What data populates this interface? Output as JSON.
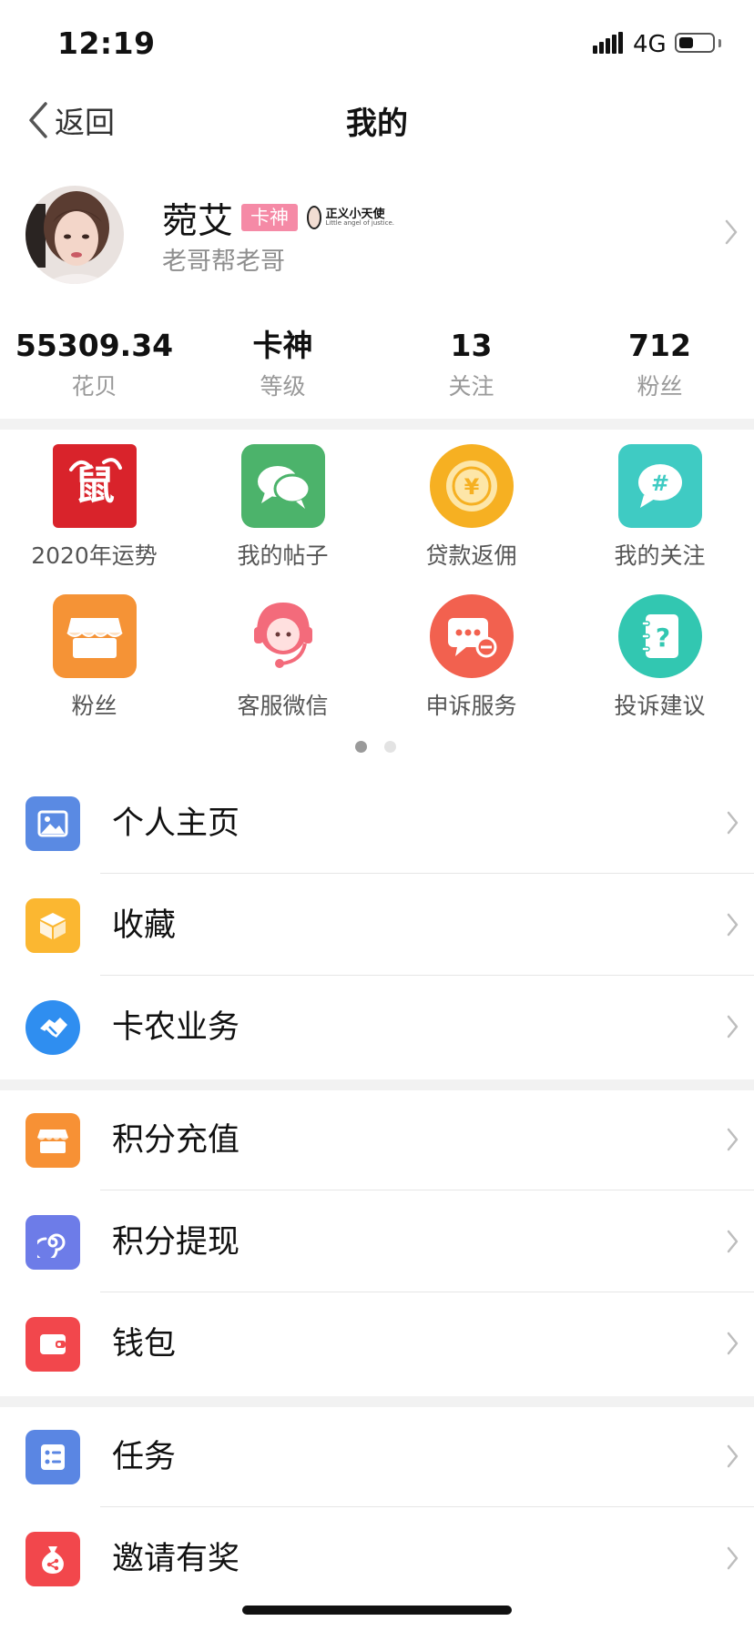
{
  "status_bar": {
    "time": "12:19",
    "network": "4G",
    "battery_level": 0.45
  },
  "nav": {
    "back_label": "返回",
    "title": "我的"
  },
  "profile": {
    "name": "菀艾",
    "rank_badge": "卡神",
    "honor_badge": {
      "title": "正义小天使",
      "subtitle": "Little angel of justice."
    },
    "subtitle": "老哥帮老哥"
  },
  "stats": [
    {
      "value": "55309.34",
      "label": "花贝"
    },
    {
      "value": "卡神",
      "label": "等级"
    },
    {
      "value": "13",
      "label": "关注"
    },
    {
      "value": "712",
      "label": "粉丝"
    }
  ],
  "grid": [
    {
      "label": "2020年运势",
      "icon": "fortune-rat-icon",
      "color": "#d9232b"
    },
    {
      "label": "我的帖子",
      "icon": "chat-bubbles-icon",
      "color": "#4cb36b"
    },
    {
      "label": "贷款返佣",
      "icon": "yen-coin-icon",
      "color": "#f6b022"
    },
    {
      "label": "我的关注",
      "icon": "hashtag-icon",
      "color": "#3fcbc3"
    },
    {
      "label": "粉丝",
      "icon": "shop-icon",
      "color": "#f59336"
    },
    {
      "label": "客服微信",
      "icon": "headset-agent-icon",
      "color": "#f36b7b"
    },
    {
      "label": "申诉服务",
      "icon": "message-dots-icon",
      "color": "#f2614f"
    },
    {
      "label": "投诉建议",
      "icon": "question-note-icon",
      "color": "#32c7b1"
    }
  ],
  "pager": {
    "pages": 2,
    "active": 1
  },
  "menu": [
    {
      "label": "个人主页",
      "icon": "image-icon",
      "color": "#5a8ae3"
    },
    {
      "label": "收藏",
      "icon": "box-icon",
      "color": "#fbb731"
    },
    {
      "label": "卡农业务",
      "icon": "handshake-icon",
      "color": "#2f8ef0"
    },
    {
      "label": "积分充值",
      "icon": "store-icon",
      "color": "#f79135"
    },
    {
      "label": "积分提现",
      "icon": "swirl-icon",
      "color": "#6d7ce8"
    },
    {
      "label": "钱包",
      "icon": "wallet-icon",
      "color": "#f2474c"
    },
    {
      "label": "任务",
      "icon": "task-list-icon",
      "color": "#5a86e3"
    },
    {
      "label": "邀请有奖",
      "icon": "gift-bag-icon",
      "color": "#f2474c"
    }
  ]
}
